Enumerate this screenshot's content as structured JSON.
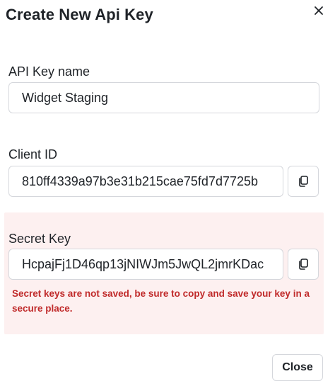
{
  "dialog": {
    "title": "Create New Api Key",
    "close_icon": "close-icon"
  },
  "api_key_name": {
    "label": "API Key name",
    "value": "Widget Staging"
  },
  "client_id": {
    "label": "Client ID",
    "value": "810ff4339a97b3e31b215cae75fd7d7725b",
    "copy_icon": "copy-icon"
  },
  "secret_key": {
    "label": "Secret Key",
    "value": "HcpajFj1D46qp13jNIWJm5JwQL2jmrKDac",
    "copy_icon": "copy-icon",
    "warning": "Secret keys are not saved, be sure to copy and save your key in a secure place.",
    "panel_color": "#fdf0f0",
    "warning_color": "#c02a2a"
  },
  "footer": {
    "close_label": "Close"
  }
}
